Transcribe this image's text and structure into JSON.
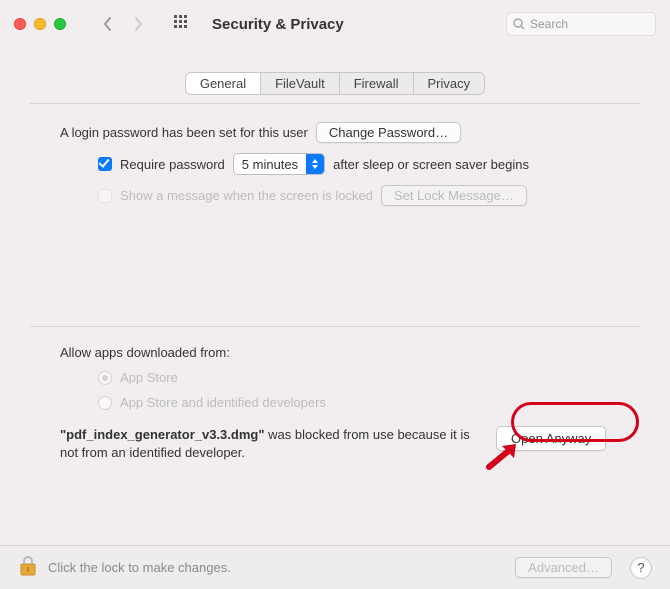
{
  "window": {
    "title": "Security & Privacy"
  },
  "search": {
    "placeholder": "Search"
  },
  "tabs": {
    "general": "General",
    "filevault": "FileVault",
    "firewall": "Firewall",
    "privacy": "Privacy"
  },
  "login": {
    "password_set_text": "A login password has been set for this user",
    "change_password": "Change Password…",
    "require_password_label": "Require password",
    "delay_value": "5 minutes",
    "after_sleep_text": "after sleep or screen saver begins",
    "show_message_label": "Show a message when the screen is locked",
    "set_lock_message": "Set Lock Message…"
  },
  "allow": {
    "heading": "Allow apps downloaded from:",
    "app_store": "App Store",
    "identified": "App Store and identified developers"
  },
  "blocked": {
    "filename": "\"pdf_index_generator_v3.3.dmg\"",
    "rest": " was blocked from use because it is not from an identified developer.",
    "open_anyway": "Open Anyway"
  },
  "footer": {
    "lock_text": "Click the lock to make changes.",
    "advanced": "Advanced…",
    "help": "?"
  }
}
